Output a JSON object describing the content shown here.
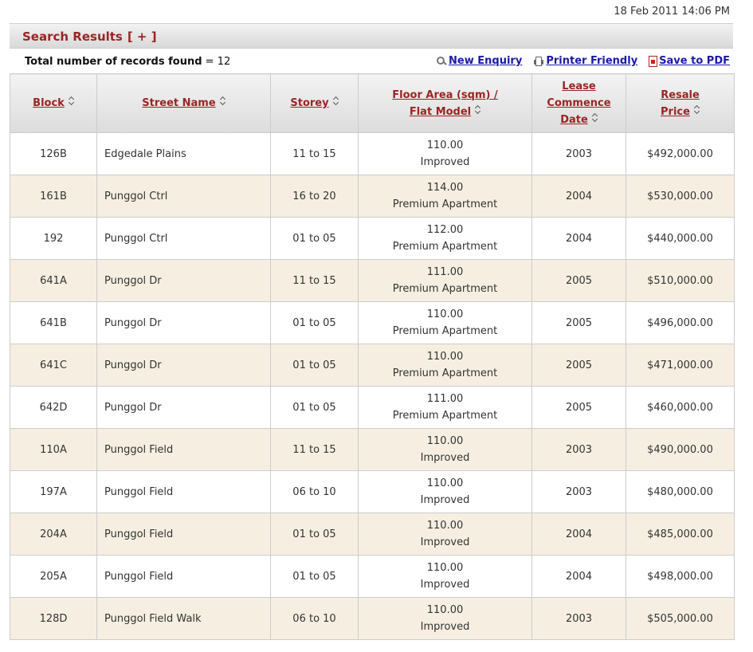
{
  "timestamp": "18 Feb 2011 14:06 PM",
  "results_header": {
    "title": "Search Results",
    "toggle": "[ + ]"
  },
  "record_count": {
    "label": "Total number of records found",
    "separator": "=",
    "value": "12"
  },
  "links": {
    "new_enquiry": "New Enquiry",
    "printer_friendly": "Printer Friendly",
    "save_pdf": "Save to PDF"
  },
  "columns": {
    "block": "Block",
    "street": "Street Name",
    "storey": "Storey",
    "floor_area_1": "Floor Area (sqm) /",
    "floor_area_2": "Flat Model",
    "lease_1": "Lease",
    "lease_2": "Commence",
    "lease_3": "Date",
    "resale_1": "Resale",
    "resale_2": "Price"
  },
  "rows": [
    {
      "block": "126B",
      "street": "Edgedale Plains",
      "storey": "11 to 15",
      "area": "110.00",
      "model": "Improved",
      "lease": "2003",
      "price": "$492,000.00"
    },
    {
      "block": "161B",
      "street": "Punggol Ctrl",
      "storey": "16 to 20",
      "area": "114.00",
      "model": "Premium Apartment",
      "lease": "2004",
      "price": "$530,000.00"
    },
    {
      "block": "192",
      "street": "Punggol Ctrl",
      "storey": "01 to 05",
      "area": "112.00",
      "model": "Premium Apartment",
      "lease": "2004",
      "price": "$440,000.00"
    },
    {
      "block": "641A",
      "street": "Punggol Dr",
      "storey": "11 to 15",
      "area": "111.00",
      "model": "Premium Apartment",
      "lease": "2005",
      "price": "$510,000.00"
    },
    {
      "block": "641B",
      "street": "Punggol Dr",
      "storey": "01 to 05",
      "area": "110.00",
      "model": "Premium Apartment",
      "lease": "2005",
      "price": "$496,000.00"
    },
    {
      "block": "641C",
      "street": "Punggol Dr",
      "storey": "01 to 05",
      "area": "110.00",
      "model": "Premium Apartment",
      "lease": "2005",
      "price": "$471,000.00"
    },
    {
      "block": "642D",
      "street": "Punggol Dr",
      "storey": "01 to 05",
      "area": "111.00",
      "model": "Premium Apartment",
      "lease": "2005",
      "price": "$460,000.00"
    },
    {
      "block": "110A",
      "street": "Punggol Field",
      "storey": "11 to 15",
      "area": "110.00",
      "model": "Improved",
      "lease": "2003",
      "price": "$490,000.00"
    },
    {
      "block": "197A",
      "street": "Punggol Field",
      "storey": "06 to 10",
      "area": "110.00",
      "model": "Improved",
      "lease": "2003",
      "price": "$480,000.00"
    },
    {
      "block": "204A",
      "street": "Punggol Field",
      "storey": "01 to 05",
      "area": "110.00",
      "model": "Improved",
      "lease": "2004",
      "price": "$485,000.00"
    },
    {
      "block": "205A",
      "street": "Punggol Field",
      "storey": "01 to 05",
      "area": "110.00",
      "model": "Improved",
      "lease": "2004",
      "price": "$498,000.00"
    },
    {
      "block": "128D",
      "street": "Punggol Field Walk",
      "storey": "06 to 10",
      "area": "110.00",
      "model": "Improved",
      "lease": "2003",
      "price": "$505,000.00"
    }
  ],
  "colors": {
    "accent": "#9b2424",
    "link": "#1a1aa6",
    "row_alt": "#f6efe1",
    "border": "#cccccc"
  },
  "icons": {
    "new_enquiry": "search-icon",
    "printer_friendly": "printer-icon",
    "save_pdf": "pdf-icon",
    "sort": "sort-icon"
  }
}
